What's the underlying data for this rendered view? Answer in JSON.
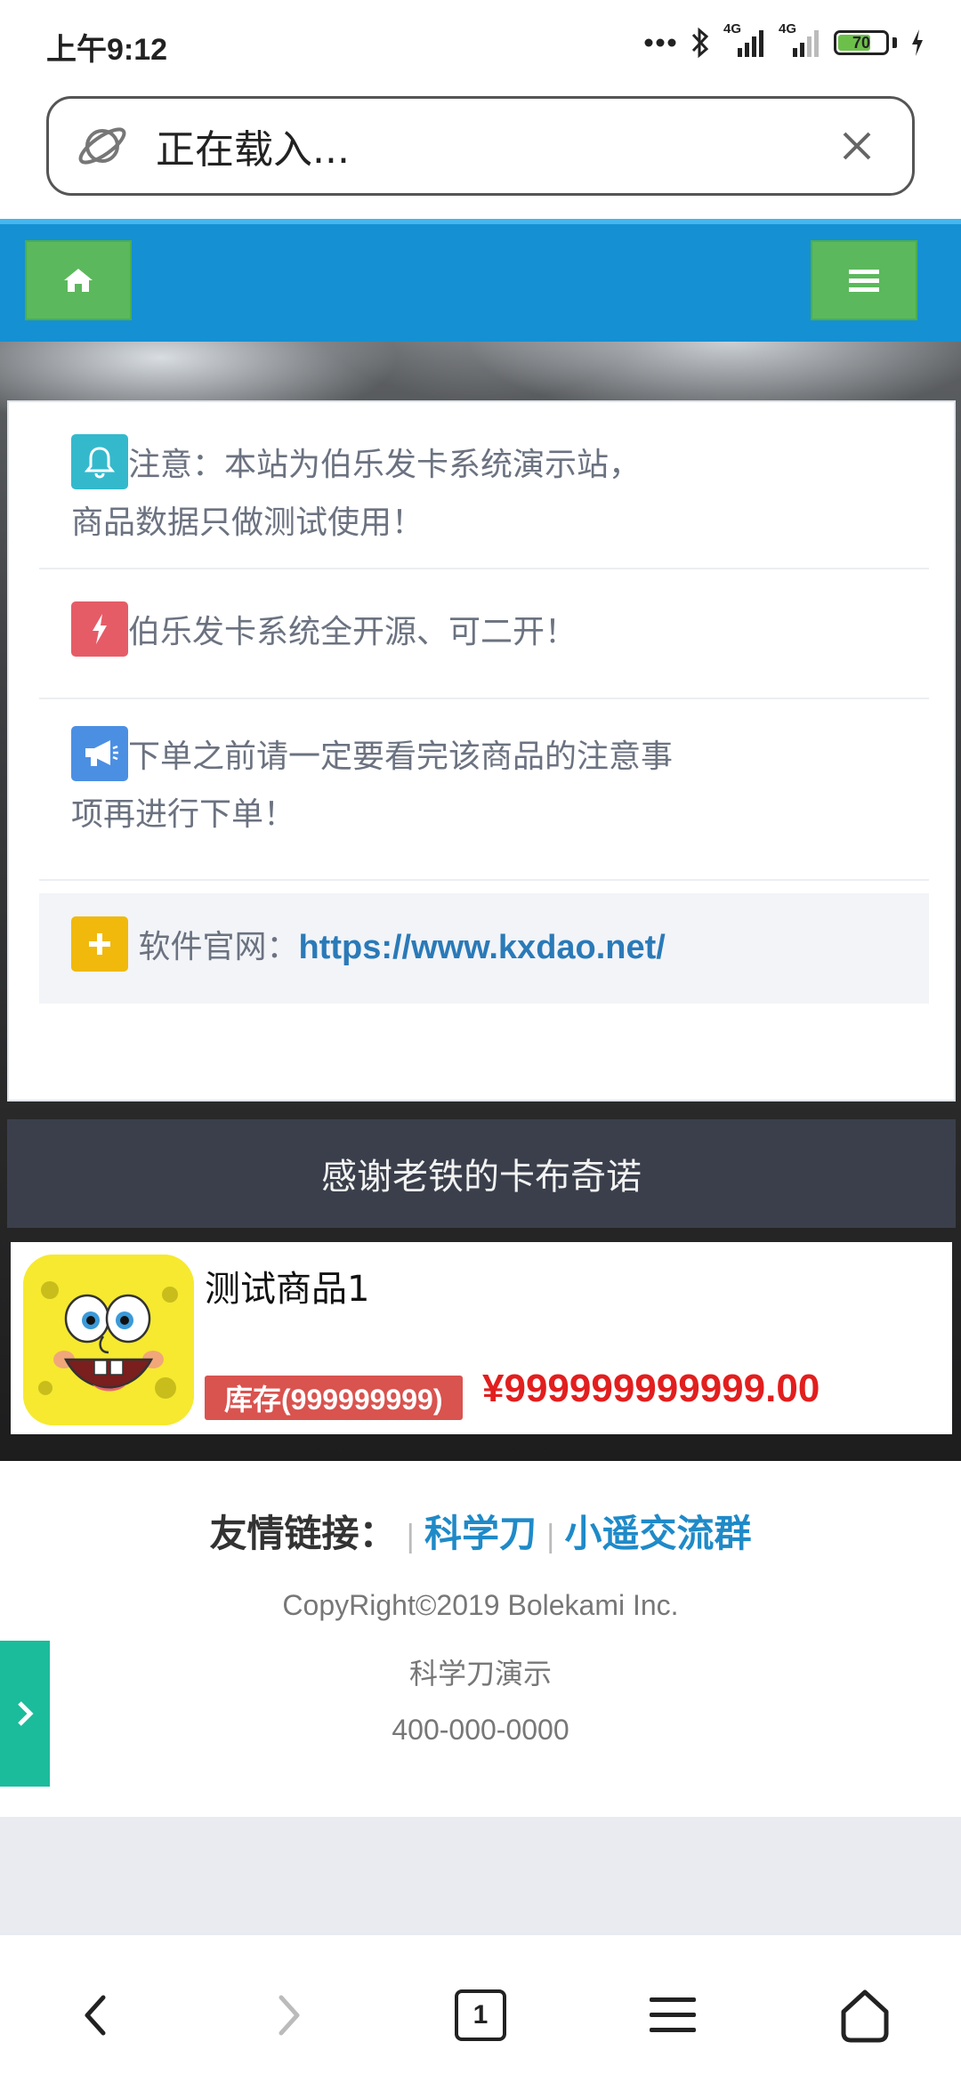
{
  "status_bar": {
    "time": "上午9:12",
    "network_1": "4G",
    "network_2": "4G",
    "battery": "70"
  },
  "url_bar": {
    "text": "正在载入..."
  },
  "notices": [
    {
      "icon": "bell-icon",
      "color": "#34b9cc",
      "text": "注意：本站为伯乐发卡系统演示站，",
      "text2": "商品数据只做测试使用！"
    },
    {
      "icon": "bolt-icon",
      "color": "#e55c67",
      "text": "伯乐发卡系统全开源、可二开！"
    },
    {
      "icon": "megaphone-icon",
      "color": "#4b8fe3",
      "text": "下单之前请一定要看完该商品的注意事",
      "text2": "项再进行下单！"
    },
    {
      "icon": "plus-icon",
      "color": "#f0b90c",
      "label": "软件官网：",
      "link": "https://www.kxdao.net/"
    }
  ],
  "category": {
    "title": "感谢老铁的卡布奇诺"
  },
  "product": {
    "name": "测试商品1",
    "stock": "库存(999999999)",
    "price": "¥999999999999.00"
  },
  "footer": {
    "friend_label": "友情链接：",
    "links": [
      "科学刀",
      "小遥交流群"
    ],
    "copyright": "CopyRight©2019 Bolekami Inc.",
    "site_name": "科学刀演示",
    "phone": "400-000-0000"
  },
  "bottom_bar": {
    "tab_count": "1"
  },
  "colors": {
    "navbar": "#1590d3",
    "nav_button": "#5cb85c",
    "category_bar": "#3a3f4b",
    "price": "#e21e1e",
    "stock_badge": "#d9534f",
    "side_tab": "#1bbc9b",
    "link": "#1f8ac8"
  }
}
